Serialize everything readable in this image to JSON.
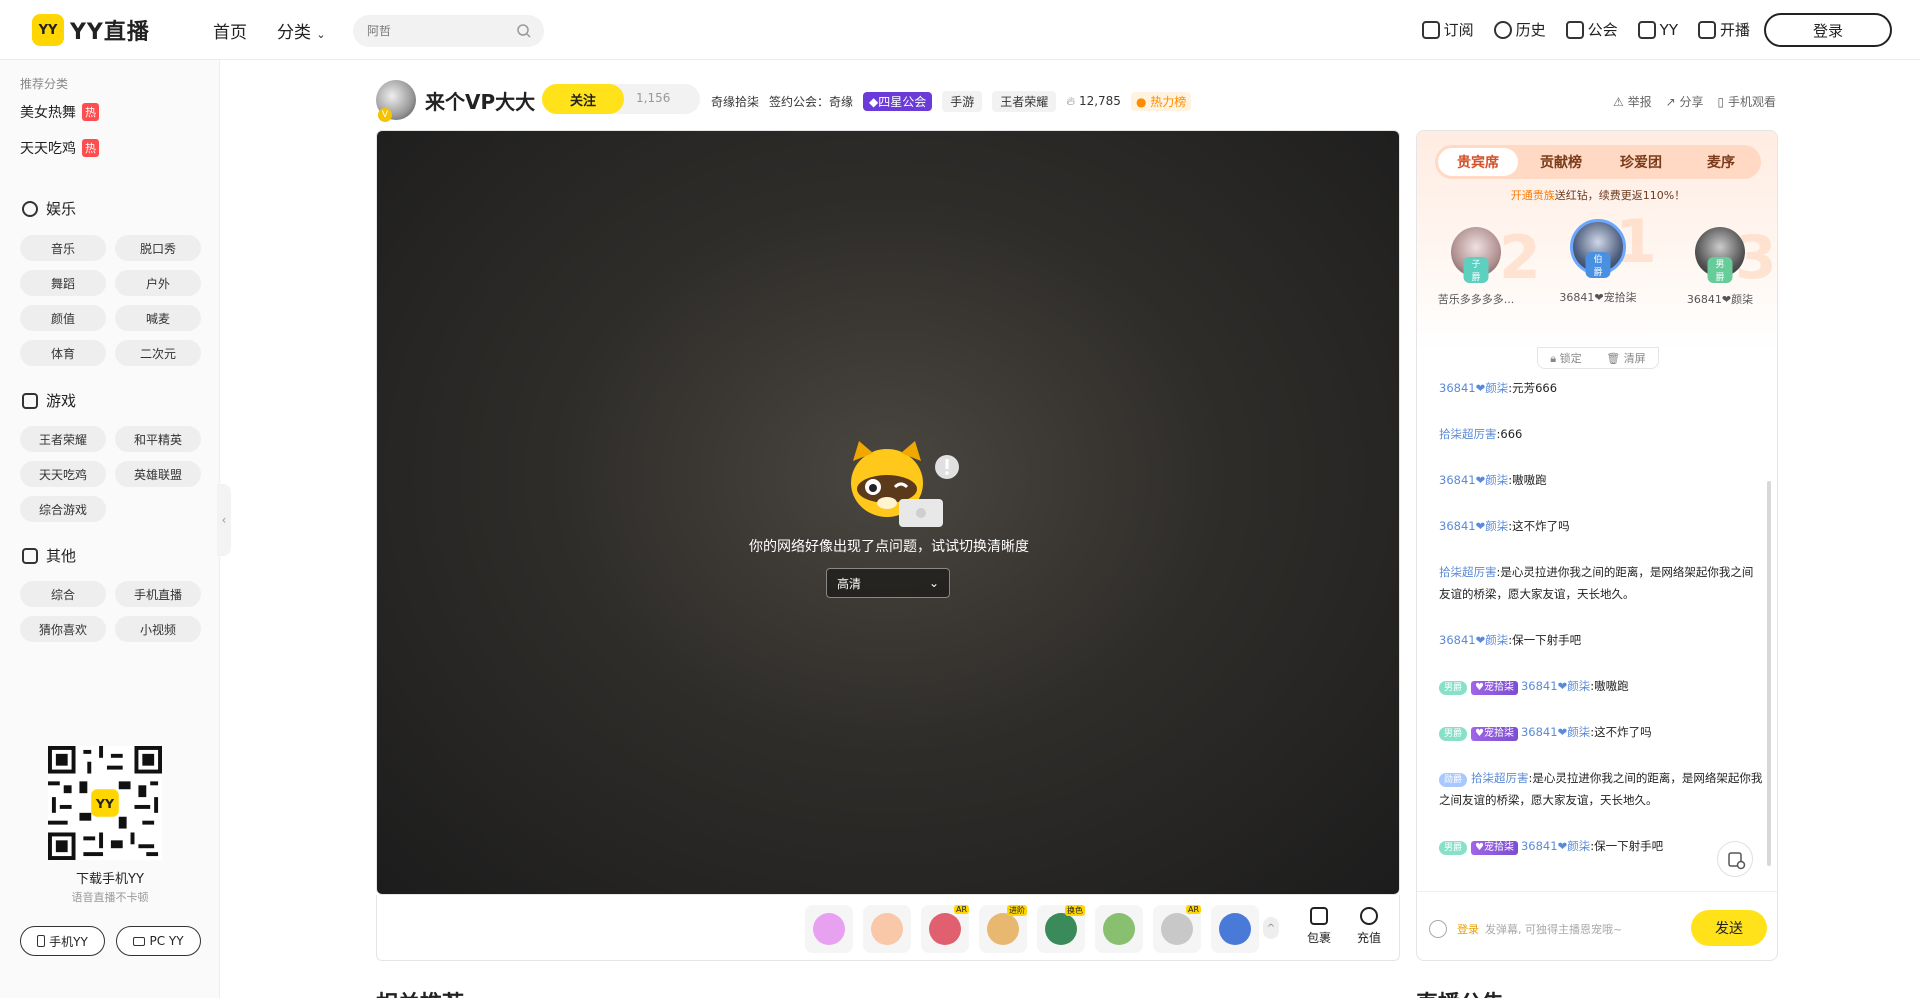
{
  "header": {
    "logo_badge": "YY",
    "logo_text": "YY直播",
    "nav": [
      "首页",
      "分类"
    ],
    "search_placeholder": "阿哲",
    "right_items": [
      "订阅",
      "历史",
      "公会",
      "YY",
      "开播"
    ],
    "login": "登录"
  },
  "sidebar": {
    "recommend_label": "推荐分类",
    "hot_items": [
      {
        "label": "美女热舞",
        "tag": "热"
      },
      {
        "label": "天天吃鸡",
        "tag": "热"
      }
    ],
    "sections": [
      {
        "title": "娱乐",
        "items": [
          "音乐",
          "脱口秀",
          "舞蹈",
          "户外",
          "颜值",
          "喊麦",
          "体育",
          "二次元"
        ]
      },
      {
        "title": "游戏",
        "items": [
          "王者荣耀",
          "和平精英",
          "天天吃鸡",
          "英雄联盟",
          "综合游戏"
        ]
      },
      {
        "title": "其他",
        "items": [
          "综合",
          "手机直播",
          "猜你喜欢",
          "小视频"
        ]
      }
    ],
    "qr_badge": "YY",
    "download_title": "下载手机YY",
    "download_sub": "语音直播不卡顿",
    "btn_mobile": "手机YY",
    "btn_pc": "PC YY",
    "collapse": "‹"
  },
  "anchor": {
    "name": "来个VP大大",
    "avatar_badge": "V",
    "follow": "关注",
    "follow_count": "1,156",
    "channel": "奇缘拾柒",
    "guild_label": "签约公会：奇缘",
    "guild_tag": "四星公会",
    "tag1": "手游",
    "tag2": "王者荣耀",
    "heat": "12,785",
    "hot_rank": "热力榜",
    "actions": [
      "举报",
      "分享",
      "手机观看"
    ]
  },
  "player": {
    "error_msg": "你的网络好像出现了点问题，试试切换清晰度",
    "quality": "高清"
  },
  "gift_bar": {
    "gifts": [
      {
        "tag": "",
        "color": "#e8a0f0"
      },
      {
        "tag": "",
        "color": "#f8c8a8"
      },
      {
        "tag": "AR",
        "color": "#e06070"
      },
      {
        "tag": "进阶",
        "color": "#e8b870"
      },
      {
        "tag": "换色",
        "color": "#3a8a5a"
      },
      {
        "tag": "",
        "color": "#88c070"
      },
      {
        "tag": "AR",
        "color": "#c8c8c8"
      },
      {
        "tag": "",
        "color": "#4a7ad8"
      }
    ],
    "more": "^",
    "pack": "包裹",
    "recharge": "充值"
  },
  "rpanel": {
    "tabs": [
      "贵宾席",
      "贡献榜",
      "珍爱团",
      "麦序"
    ],
    "promo_hl": "开通贵族",
    "promo_rest": "送红钻，续费更返110%！",
    "seats": [
      {
        "name": "苦乐多多多多...",
        "rank": "子爵",
        "rank_color": "#5dd0c0"
      },
      {
        "name": "36841❤宠拾柒",
        "rank": "伯爵",
        "rank_color": "#4a90e2"
      },
      {
        "name": "36841❤颜柒",
        "rank": "男爵",
        "rank_color": "#66cc99"
      }
    ],
    "seat_nums": [
      "2",
      "1",
      "3"
    ],
    "lock": "锁定",
    "clear": "清屏",
    "messages": [
      {
        "nick": "36841❤颜柒",
        "text": ":元芳666"
      },
      {
        "nick": "拾柒超厉害",
        "text": ":666"
      },
      {
        "nick": "36841❤颜柒",
        "text": ":嗷嗷跑"
      },
      {
        "nick": "36841❤颜柒",
        "text": ":这不炸了吗"
      },
      {
        "nick": "拾柒超厉害",
        "text": ":是心灵拉进你我之间的距离，是网络架起你我之间友谊的桥梁，愿大家友谊，天长地久。"
      },
      {
        "nick": "36841❤颜柒",
        "text": ":保一下射手吧"
      },
      {
        "level": "男爵",
        "fan": "宠拾柒",
        "nick": "36841❤颜柒",
        "text": ":嗷嗷跑"
      },
      {
        "level": "男爵",
        "fan": "宠拾柒",
        "nick": "36841❤颜柒",
        "text": ":这不炸了吗"
      },
      {
        "level": "勋爵",
        "nick": "拾柒超厉害",
        "text": ":是心灵拉进你我之间的距离，是网络架起你我之间友谊的桥梁，愿大家友谊，天长地久。"
      },
      {
        "level": "男爵",
        "fan": "宠拾柒",
        "nick": "36841❤颜柒",
        "text": ":保一下射手吧"
      }
    ],
    "input_login": "登录",
    "input_placeholder": "发弹幕, 可独得主播恩宠哦~",
    "send": "发送"
  },
  "bottom": {
    "left_title": "相关推荐",
    "right_title": "直播公告"
  }
}
